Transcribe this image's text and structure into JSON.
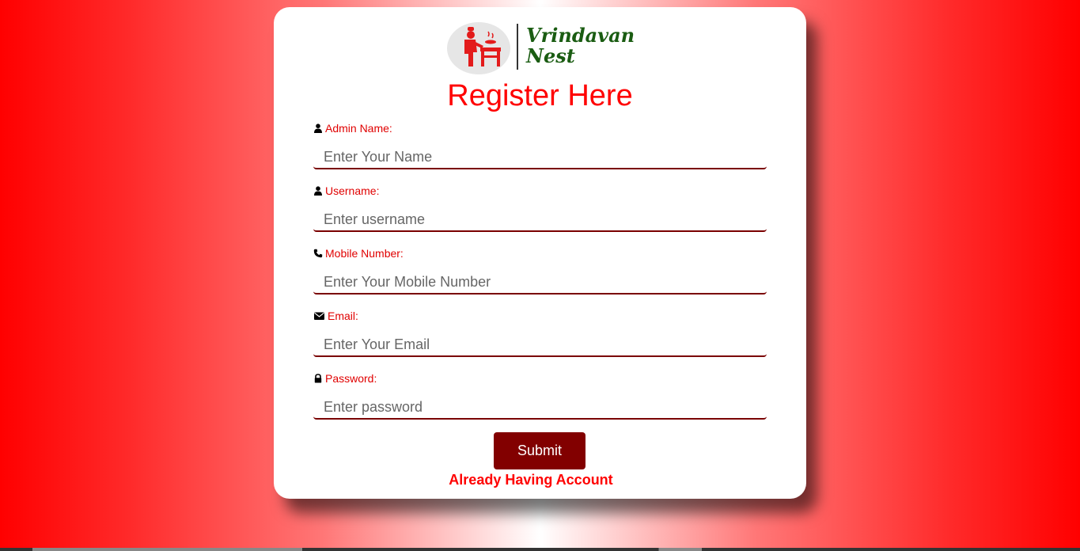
{
  "brand": {
    "name_line1": "Vrindavan",
    "name_line2": "Nest",
    "logo_icon": "chef-cooking-icon"
  },
  "form": {
    "title": "Register Here",
    "fields": [
      {
        "label": "Admin Name:",
        "placeholder": "Enter Your Name",
        "icon": "user-icon",
        "value": ""
      },
      {
        "label": "Username:",
        "placeholder": "Enter username",
        "icon": "user-icon",
        "value": ""
      },
      {
        "label": "Mobile Number:",
        "placeholder": "Enter Your Mobile Number",
        "icon": "phone-icon",
        "value": ""
      },
      {
        "label": "Email:",
        "placeholder": "Enter Your Email",
        "icon": "envelope-icon",
        "value": ""
      },
      {
        "label": "Password:",
        "placeholder": "Enter password",
        "icon": "lock-icon",
        "value": ""
      }
    ],
    "submit_label": "Submit",
    "login_link": "Already Having Account"
  },
  "colors": {
    "accent": "#ff0000",
    "button": "#820000",
    "brand_green": "#1a5c12"
  }
}
